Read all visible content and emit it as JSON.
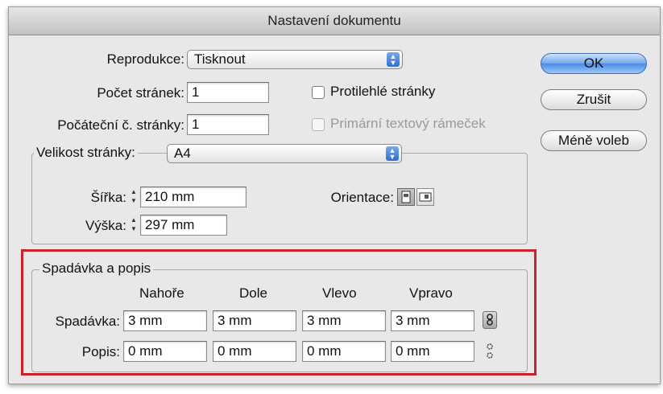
{
  "window": {
    "title": "Nastavení dokumentu"
  },
  "main": {
    "reprodukce": {
      "label": "Reprodukce:",
      "value": "Tisknout"
    },
    "pocet_stranek": {
      "label": "Počet stránek:",
      "value": "1"
    },
    "pocatecni_stranka": {
      "label": "Počáteční č. stránky:",
      "value": "1"
    },
    "protilehle": {
      "label": "Protilehlé stránky",
      "checked": false
    },
    "primarni_ramecek": {
      "label": "Primární textový rámeček",
      "checked": false,
      "disabled": true
    }
  },
  "buttons": {
    "ok": "OK",
    "cancel": "Zrušit",
    "fewer_options": "Méně voleb"
  },
  "page_size": {
    "label": "Velikost stránky:",
    "value": "A4",
    "width": {
      "label": "Šířka:",
      "value": "210 mm"
    },
    "height": {
      "label": "Výška:",
      "value": "297 mm"
    },
    "orientation": {
      "label": "Orientace:",
      "selected": "portrait"
    }
  },
  "bleed_slug": {
    "title": "Spadávka a popis",
    "columns": [
      "Nahoře",
      "Dole",
      "Vlevo",
      "Vpravo"
    ],
    "bleed": {
      "label": "Spadávka:",
      "values": [
        "3 mm",
        "3 mm",
        "3 mm",
        "3 mm"
      ],
      "linked": true
    },
    "slug": {
      "label": "Popis:",
      "values": [
        "0 mm",
        "0 mm",
        "0 mm",
        "0 mm"
      ],
      "linked": false
    }
  },
  "colors": {
    "highlight": "#c8232c",
    "primary_button": "#4b8be5"
  }
}
